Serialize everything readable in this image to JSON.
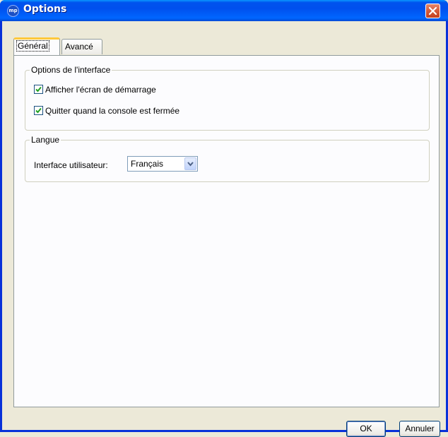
{
  "window": {
    "title": "Options",
    "app_icon_text": "mp"
  },
  "tabs": [
    {
      "label": "Général",
      "active": true
    },
    {
      "label": "Avancé",
      "active": false
    }
  ],
  "interface_group": {
    "legend": "Options de l'interface",
    "options": [
      {
        "label": "Afficher l'écran de démarrage",
        "checked": true
      },
      {
        "label": "Quitter quand la console est fermée",
        "checked": true
      }
    ]
  },
  "language_group": {
    "legend": "Langue",
    "field_label": "Interface utilisateur:",
    "selected": "Français"
  },
  "buttons": {
    "ok": "OK",
    "cancel": "Annuler"
  },
  "colors": {
    "titlebar": "#0053ee",
    "tab_highlight": "#ffc83c",
    "check": "#21a121",
    "close": "#d55b3a"
  }
}
